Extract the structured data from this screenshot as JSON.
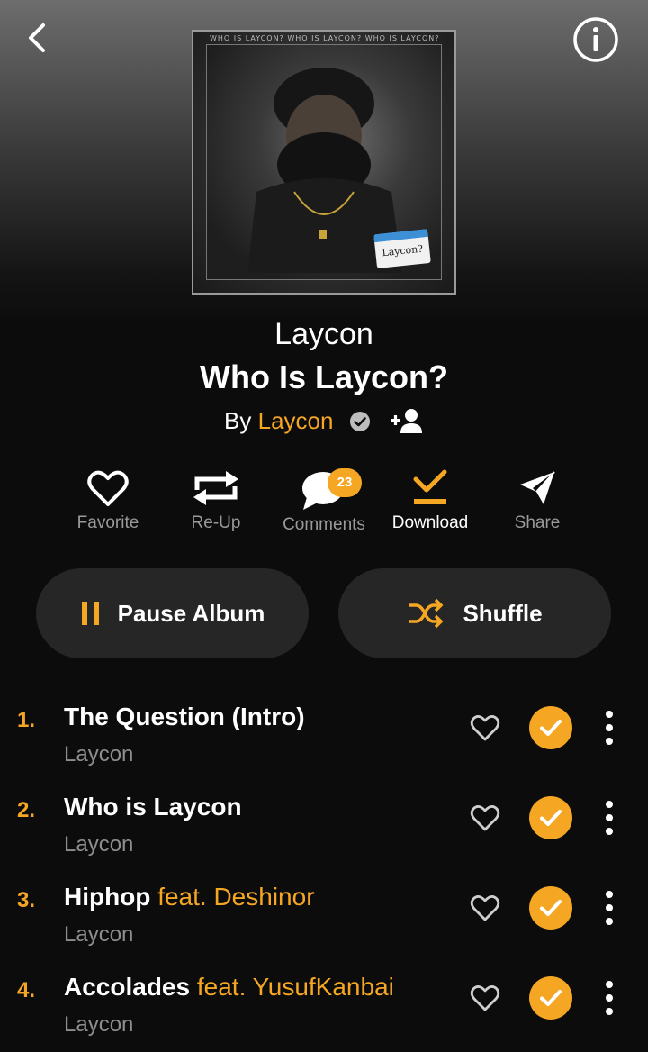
{
  "header": {
    "back_icon": "chevron-left-icon",
    "info_icon": "info-icon"
  },
  "album": {
    "cover_tag": "Laycon?",
    "cover_edge_text": "WHO IS LAYCON? WHO IS LAYCON? WHO IS LAYCON?",
    "artist": "Laycon",
    "title": "Who Is Laycon?",
    "by_prefix": "By",
    "by_artist": "Laycon"
  },
  "actions": {
    "favorite": "Favorite",
    "reup": "Re-Up",
    "comments": "Comments",
    "comments_count": "23",
    "download": "Download",
    "share": "Share"
  },
  "controls": {
    "pause_label": "Pause Album",
    "shuffle_label": "Shuffle"
  },
  "colors": {
    "accent": "#f5a623",
    "background": "#0c0c0c",
    "pill": "#262626",
    "muted": "#9a9a9a"
  },
  "tracks": [
    {
      "num": "1.",
      "title": "The Question (Intro)",
      "feat": "",
      "artist": "Laycon"
    },
    {
      "num": "2.",
      "title": "Who is Laycon",
      "feat": "",
      "artist": "Laycon"
    },
    {
      "num": "3.",
      "title": "Hiphop",
      "feat": "feat. Deshinor",
      "artist": "Laycon"
    },
    {
      "num": "4.",
      "title": "Accolades",
      "feat": "feat. YusufKanbai",
      "artist": "Laycon"
    }
  ]
}
